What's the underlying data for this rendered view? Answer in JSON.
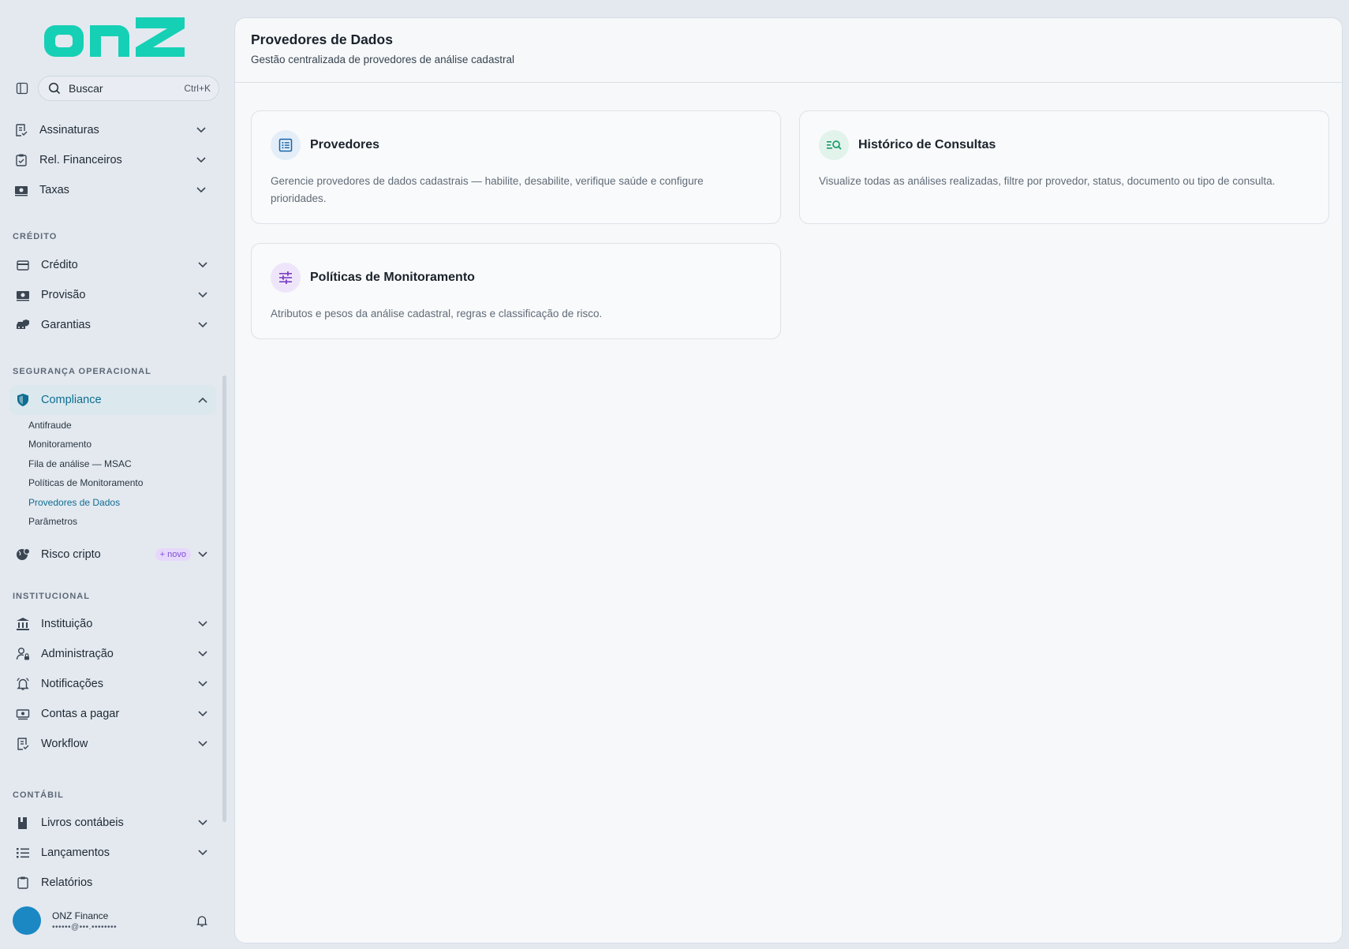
{
  "brand": {
    "logo_text": "onz",
    "accent": "#16d0b5"
  },
  "search": {
    "label": "Buscar",
    "shortcut": "Ctrl+K"
  },
  "nav": {
    "top_items": [
      {
        "label": "Assinaturas",
        "icon": "document-check-icon"
      },
      {
        "label": "Rel. Financeiros",
        "icon": "clipboard-icon"
      },
      {
        "label": "Taxas",
        "icon": "money-icon"
      }
    ],
    "sections": {
      "credito": "CRÉDITO",
      "seguranca": "SEGURANÇA OPERACIONAL",
      "institucional": "INSTITUCIONAL",
      "contabil": "CONTÁBIL"
    },
    "credito_items": [
      {
        "label": "Crédito"
      },
      {
        "label": "Provisão"
      },
      {
        "label": "Garantias"
      }
    ],
    "compliance": {
      "label": "Compliance",
      "sub_items": [
        "Antifraude",
        "Monitoramento",
        "Fila de análise — MSAC",
        "Políticas de Monitoramento",
        "Provedores de Dados",
        "Parâmetros"
      ]
    },
    "risco": {
      "label": "Risco cripto",
      "badge": "+ novo"
    },
    "institucional_items": [
      {
        "label": "Instituição"
      },
      {
        "label": "Administração"
      },
      {
        "label": "Notificações"
      },
      {
        "label": "Contas a pagar"
      },
      {
        "label": "Workflow"
      }
    ],
    "contabil_items": [
      {
        "label": "Livros contábeis"
      },
      {
        "label": "Lançamentos"
      },
      {
        "label": "Relatórios"
      }
    ]
  },
  "user": {
    "name": "ONZ Finance",
    "email": "••••••@•••.••••••••"
  },
  "page": {
    "title": "Provedores de Dados",
    "subtitle": "Gestão centralizada de provedores de análise cadastral"
  },
  "cards": [
    {
      "title": "Provedores",
      "description": "Gerencie provedores de dados cadastrais — habilite, desabilite, verifique saúde e configure prioridades.",
      "icon": "list-icon",
      "color": "#1763a8"
    },
    {
      "title": "Histórico de Consultas",
      "description": "Visualize todas as análises realizadas, filtre por provedor, status, documento ou tipo de consulta.",
      "icon": "search-list-icon",
      "color": "#169b6a"
    },
    {
      "title": "Políticas de Monitoramento",
      "description": "Atributos e pesos da análise cadastral, regras e classificação de risco.",
      "icon": "sliders-icon",
      "color": "#7a3fc4"
    }
  ]
}
